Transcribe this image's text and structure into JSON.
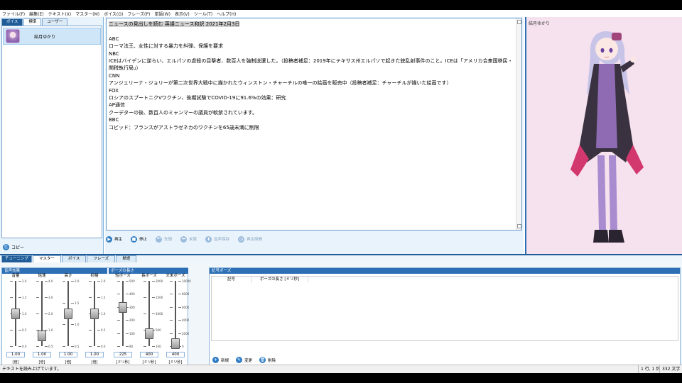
{
  "menubar": [
    "ファイル(F)",
    "編集(E)",
    "テキスト(X)",
    "マスター(M)",
    "ボイス(O)",
    "フレーズ(P)",
    "単語(W)",
    "表示(V)",
    "ツール(T)",
    "ヘルプ(H)"
  ],
  "voice_panel": {
    "tabs": [
      "ボイス",
      "標準",
      "ユーザー"
    ],
    "selected_voice": "結月ゆかり",
    "copy_label": "コピー"
  },
  "editor": {
    "lines": [
      "ニュースの見出しを読む 英語ニュース和訳 2021年2月3日",
      "",
      "ABC",
      "ローマ法王、女性に対する暴力を糾弾、保護を要求",
      "NBC",
      "ICEはバイデンに逆らい、エルパソの虐殺の目撃者、数百人を強制送還した。（投稿者補足：2019年にテキサス州エルパソで起きた銃乱射事件のこと。ICEは「アメリカ合衆国移民・",
      "関税執行局」）",
      "CNN",
      "アンジェリーナ・ジョリーが第二次世界大戦中に描かれたウィンストン・チャーチルの唯一の絵画を販売中（投稿者補足：チャーチルが描いた絵画です）",
      "FOX",
      "ロシアのスプートニクVワクチン、後期試験でCOVID-19に91.6%の効果：研究",
      "AP通信",
      "クーデターの後、数百人のミャンマーの議員が軟禁されています。",
      "BBC",
      "コビッド：フランスがアストラゼネカのワクチンを65歳未満に制限"
    ]
  },
  "playbar": [
    {
      "label": "再生",
      "icon": "play-icon",
      "enabled": true
    },
    {
      "label": "停止",
      "icon": "stop-icon",
      "enabled": true
    },
    {
      "label": "先頭",
      "icon": "skip-back-icon",
      "enabled": false
    },
    {
      "label": "末尾",
      "icon": "skip-forward-icon",
      "enabled": false
    },
    {
      "label": "音声保存",
      "icon": "save-audio-icon",
      "enabled": false
    },
    {
      "label": "再生時間",
      "icon": "clock-icon",
      "enabled": false
    }
  ],
  "character_panel": {
    "name": "結月ゆかり"
  },
  "bottom_tabs": [
    "チューニング",
    "マスター",
    "ボイス",
    "フレーズ",
    "単語"
  ],
  "effects": {
    "header": "音声効果",
    "pause_header": "ポーズの長さ",
    "sliders": [
      {
        "label": "音量",
        "value": "1.00",
        "unit": "[倍]",
        "level": 0.5,
        "scale": [
          "2.0",
          "1.5",
          "1.0",
          "0.5",
          "0.0"
        ]
      },
      {
        "label": "話速",
        "value": "1.00",
        "unit": "[倍]",
        "level": 0.167,
        "scale": [
          "4.0",
          "3.0",
          "2.0",
          "1.0",
          "0.5"
        ]
      },
      {
        "label": "高さ",
        "value": "1.00",
        "unit": "[倍]",
        "level": 0.5,
        "scale": [
          "2.0",
          "1.5",
          "1.0",
          "0.5"
        ]
      },
      {
        "label": "抑揚",
        "value": "1.00",
        "unit": "[倍]",
        "level": 0.5,
        "scale": [
          "2.0",
          "1.5",
          "1.0",
          "0.5",
          "0.0"
        ]
      },
      {
        "label": "短ポーズ",
        "value": "225",
        "unit": "[ミリ秒]",
        "level": 0.6,
        "scale": [
          "500",
          "400",
          "300",
          "200",
          "100",
          "80"
        ]
      },
      {
        "label": "長ポーズ",
        "value": "400",
        "unit": "[ミリ秒]",
        "level": 0.2,
        "scale": [
          "2000",
          "1500",
          "1000",
          "500",
          "100"
        ]
      },
      {
        "label": "文末ポーズ",
        "value": "400",
        "unit": "[ミリ秒]",
        "level": 0.04,
        "scale": [
          "10000",
          "8000",
          "6000",
          "4000",
          "2000",
          "0"
        ]
      }
    ]
  },
  "symbol_pause": {
    "header": "記号ポーズ",
    "columns": [
      "記号",
      "ポーズの長さ [ミリ秒]"
    ],
    "buttons": [
      {
        "label": "新規",
        "icon": "new-icon"
      },
      {
        "label": "変更",
        "icon": "edit-icon"
      },
      {
        "label": "削除",
        "icon": "delete-icon"
      }
    ]
  },
  "statusbar": {
    "message": "テキストを読み上げています。",
    "position": "1 行, 1 列",
    "char_count": "332 文字"
  }
}
